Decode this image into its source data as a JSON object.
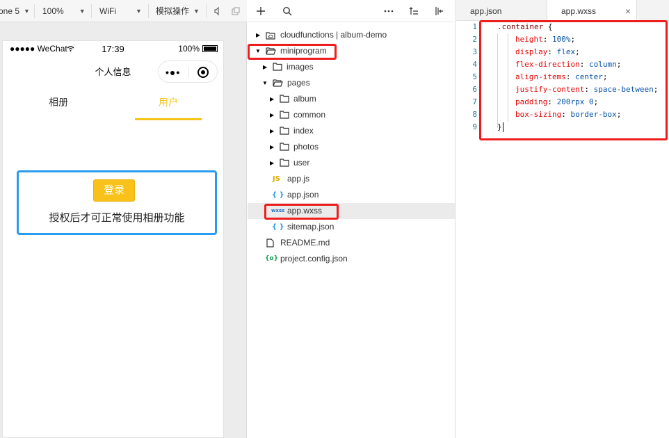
{
  "simulator": {
    "toolbar": {
      "device": "one 5",
      "zoom": "100%",
      "network": "WiFi",
      "simulate": "模拟操作"
    },
    "status_bar": {
      "carrier": "●●●●● WeChat",
      "time": "17:39",
      "battery": "100%"
    },
    "nav_title": "个人信息",
    "tabs": [
      "相册",
      "用户"
    ],
    "active_tab_color": "#f5c518",
    "login_button": "登录",
    "login_hint": "授权后才可正常使用相册功能",
    "highlight_color": "#2a9bf0"
  },
  "file_tree": {
    "toolbar_icons": [
      "plus-icon",
      "search-icon",
      "more-icon",
      "sort-icon",
      "collapse-icon"
    ],
    "items": [
      {
        "label": "cloudfunctions | album-demo",
        "type": "cloud-folder",
        "expanded": false
      },
      {
        "label": "miniprogram",
        "type": "folder",
        "expanded": true
      },
      {
        "label": "images",
        "type": "folder",
        "expanded": false
      },
      {
        "label": "pages",
        "type": "folder",
        "expanded": true
      },
      {
        "label": "album",
        "type": "folder",
        "expanded": false
      },
      {
        "label": "common",
        "type": "folder",
        "expanded": false
      },
      {
        "label": "index",
        "type": "folder",
        "expanded": false
      },
      {
        "label": "photos",
        "type": "folder",
        "expanded": false
      },
      {
        "label": "user",
        "type": "folder",
        "expanded": false
      },
      {
        "label": "app.js",
        "type": "js",
        "badge": "JS"
      },
      {
        "label": "app.json",
        "type": "json",
        "badge": "{ }"
      },
      {
        "label": "app.wxss",
        "type": "wxss",
        "badge": "wxss",
        "selected": true
      },
      {
        "label": "sitemap.json",
        "type": "json",
        "badge": "{ }"
      },
      {
        "label": "README.md",
        "type": "file"
      },
      {
        "label": "project.config.json",
        "type": "config",
        "badge": "{o}"
      }
    ]
  },
  "editor": {
    "tabs": [
      {
        "label": "app.json",
        "active": false
      },
      {
        "label": "app.wxss",
        "active": true,
        "close": "×"
      }
    ],
    "line_numbers": [
      "1",
      "2",
      "3",
      "4",
      "5",
      "6",
      "7",
      "8",
      "9"
    ],
    "code": {
      "l1_selector": ".container",
      "l1_brace": " {",
      "l2_prop": "height",
      "l2_val": "100%",
      "l3_prop": "display",
      "l3_val": "flex",
      "l4_prop": "flex-direction",
      "l4_val": "column",
      "l5_prop": "align-items",
      "l5_val": "center",
      "l6_prop": "justify-content",
      "l6_val": "space-between",
      "l7_prop": "padding",
      "l7_val": "200rpx 0",
      "l8_prop": "box-sizing",
      "l8_val": "border-box",
      "l9_brace": "}"
    },
    "colon": ": ",
    "semicolon": ";"
  },
  "annotation_color": "#ee1c1c"
}
